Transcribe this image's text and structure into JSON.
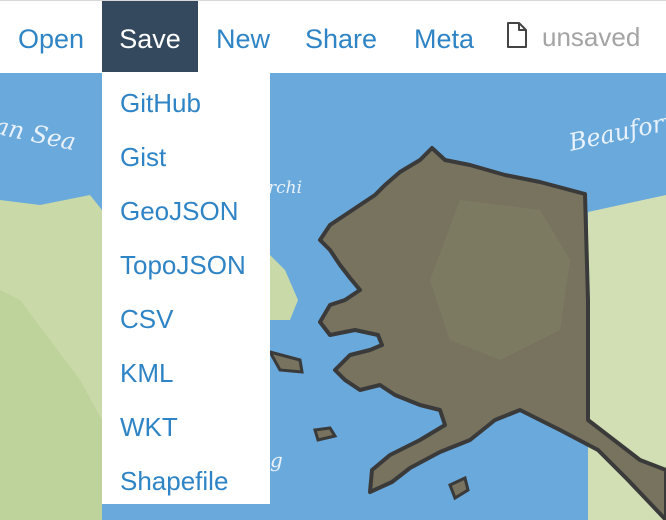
{
  "nav": {
    "items": [
      {
        "label": "Open"
      },
      {
        "label": "Save"
      },
      {
        "label": "New"
      },
      {
        "label": "Share"
      },
      {
        "label": "Meta"
      }
    ],
    "status_icon": "file-icon",
    "status_text": "unsaved"
  },
  "save_menu": {
    "items": [
      "GitHub",
      "Gist",
      "GeoJSON",
      "TopoJSON",
      "CSV",
      "KML",
      "WKT",
      "Shapefile"
    ]
  },
  "map": {
    "labels": {
      "sea_fragment": "an Sea",
      "beaufort_fragment": "Beaufort",
      "chukchi_fragment": "rchi",
      "gulf_fragment": "g"
    },
    "colors": {
      "water": "#6aa9dc",
      "land": "#c9d9a8",
      "polygon_fill": "#77735e",
      "polygon_stroke": "#3a3a3a"
    }
  },
  "colors": {
    "accent": "#2f84c5",
    "active_bg": "#34495e",
    "muted_text": "#a4a4a4"
  }
}
